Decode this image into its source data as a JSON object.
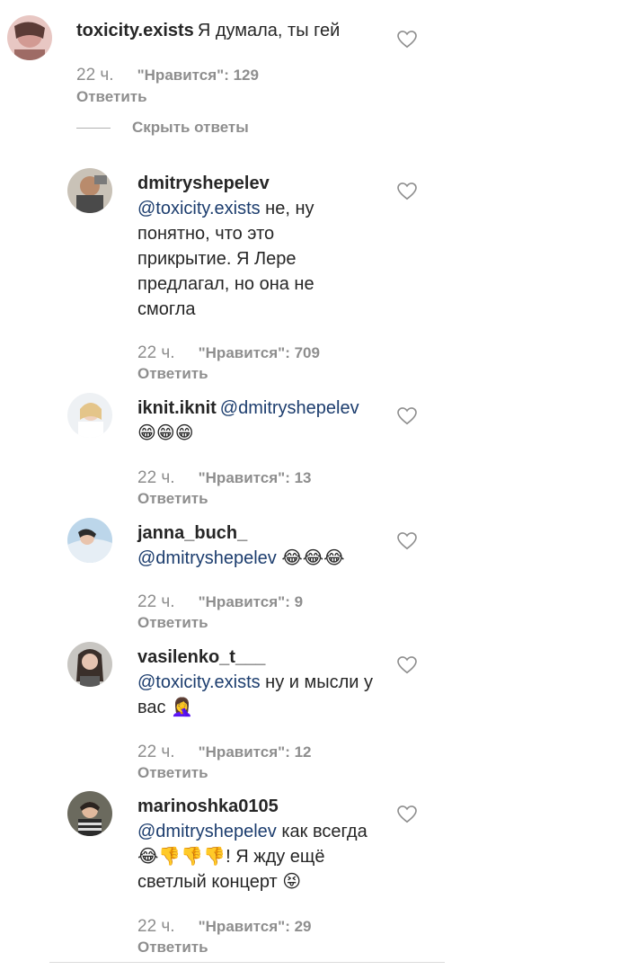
{
  "comments": [
    {
      "username": "toxicity.exists",
      "mention": "",
      "text": "Я думала, ты гей",
      "time": "22 ч.",
      "likes": "\"Нравится\": 129",
      "reply": "Ответить"
    },
    {
      "username": "dmitryshepelev",
      "mention": "@toxicity.exists",
      "text": " не, ну понятно, что это прикрытие. Я Лере предлагал, но она не смогла",
      "time": "22 ч.",
      "likes": "\"Нравится\": 709",
      "reply": "Ответить"
    },
    {
      "username": "iknit.iknit",
      "mention": "@dmitryshepelev",
      "text": "😁😁😁",
      "time": "22 ч.",
      "likes": "\"Нравится\": 13",
      "reply": "Ответить"
    },
    {
      "username": "janna_buch_",
      "mention": "@dmitryshepelev",
      "text": " 😂😂😂",
      "time": "22 ч.",
      "likes": "\"Нравится\": 9",
      "reply": "Ответить"
    },
    {
      "username": "vasilenko_t___",
      "mention": "@toxicity.exists",
      "text": " ну и мысли у вас 🤦‍♀️",
      "time": "22 ч.",
      "likes": "\"Нравится\": 12",
      "reply": "Ответить"
    },
    {
      "username": "marinoshka0105",
      "mention": "@dmitryshepelev",
      "text": " как всегда 😂👎👎👎! Я жду ещё светлый концерт 😝",
      "time": "22 ч.",
      "likes": "\"Нравится\": 29",
      "reply": "Ответить"
    }
  ],
  "hide_replies": "Скрыть ответы",
  "icons": {
    "like": "heart-outline-icon"
  },
  "colors": {
    "text": "#262626",
    "secondary": "#8e8e8e",
    "mention": "#1c3d6e"
  }
}
